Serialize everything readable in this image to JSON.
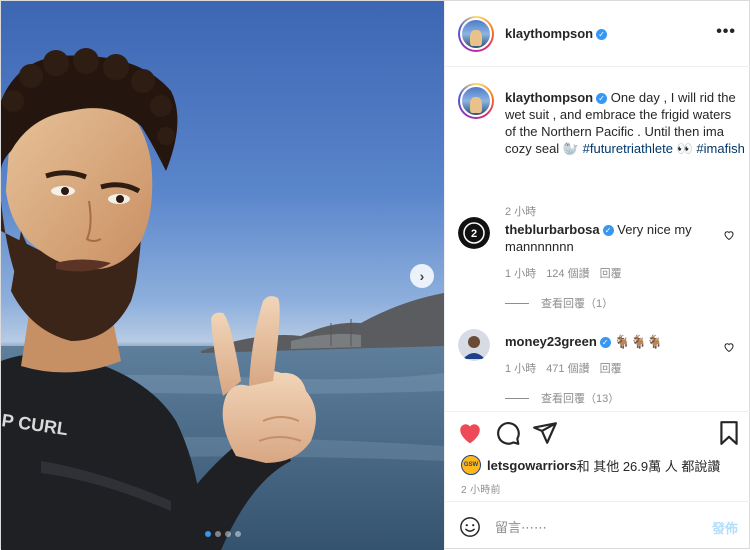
{
  "post": {
    "username": "klaythompson",
    "more_glyph": "•••",
    "caption": {
      "text": "One day , I will rid the wet suit , and embrace the frigid waters of the Northern Pacific . Until then ima cozy seal 🦭",
      "hashtag_1": "#futuretriathlete",
      "emoji": "👀",
      "hashtag_2": "#imafish",
      "time": "2 小時"
    },
    "wetsuit_logo": "P CURL",
    "carousel": {
      "next_glyph": "›",
      "total": 4,
      "active": 1
    }
  },
  "comments": [
    {
      "username": "theblurbarbosa",
      "text": "Very nice my mannnnnnn",
      "time": "1 小時",
      "likes": "124 個讚",
      "reply": "回覆",
      "view_replies": "查看回覆（1）"
    },
    {
      "username": "money23green",
      "text": "🐐🐐🐐",
      "time": "1 小時",
      "likes": "471 個讚",
      "reply": "回覆",
      "view_replies": "查看回覆（13）"
    }
  ],
  "likes_summary": {
    "liker": "letsgowarriors",
    "rest": " 和 其他 26.9萬 人 都說讚",
    "avatar_text": "GSW"
  },
  "post_time": "2 小時前",
  "comment_box": {
    "placeholder": "留言⋯⋯",
    "post_label": "發佈"
  },
  "colors": {
    "like_red": "#ed4956",
    "verified_blue": "#3897f0",
    "hashtag": "#00376b",
    "muted": "#8e8e8e",
    "post_disabled": "#b2dffc"
  },
  "icons": [
    "heart-icon",
    "comment-icon",
    "share-icon",
    "bookmark-icon",
    "smile-icon",
    "more-icon",
    "chevron-right-icon",
    "verified-icon"
  ]
}
